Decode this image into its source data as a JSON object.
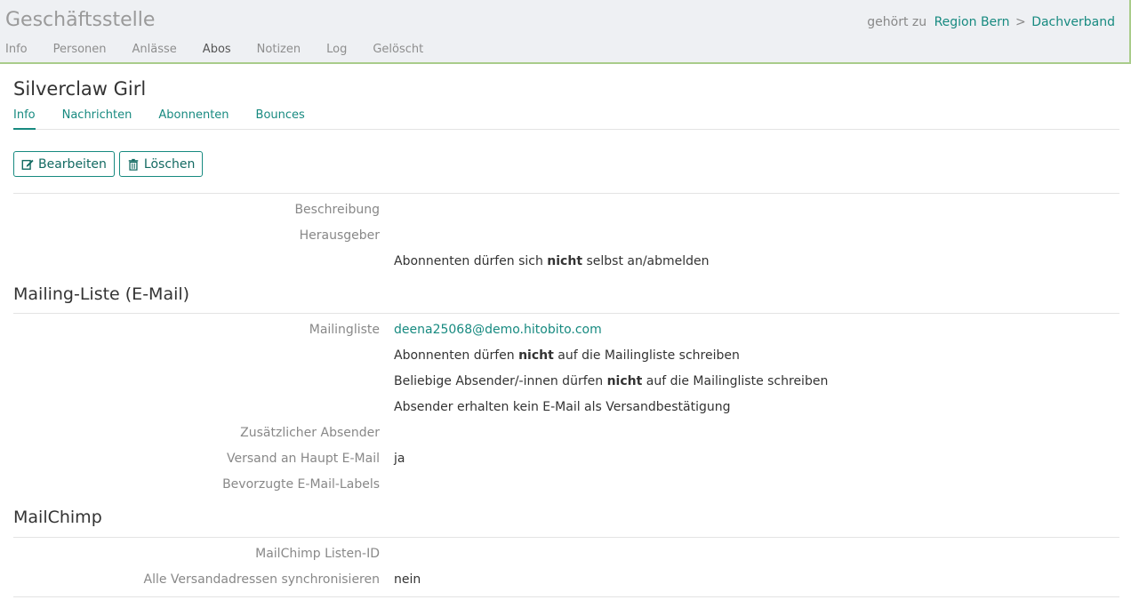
{
  "header": {
    "group_title": "Geschäftsstelle",
    "belongs_to_label": "gehört zu",
    "crumbs": [
      "Region Bern",
      ">",
      "Dachverband"
    ],
    "nav": [
      "Info",
      "Personen",
      "Anlässe",
      "Abos",
      "Notizen",
      "Log",
      "Gelöscht"
    ],
    "active_nav": "Abos"
  },
  "page": {
    "title": "Silverclaw Girl",
    "tabs": [
      "Info",
      "Nachrichten",
      "Abonnenten",
      "Bounces"
    ],
    "active_tab": "Info"
  },
  "actions": {
    "edit": "Bearbeiten",
    "delete": "Löschen"
  },
  "general": {
    "beschreibung_label": "Beschreibung",
    "herausgeber_label": "Herausgeber",
    "subscribe_text": {
      "pre": "Abonnenten dürfen sich",
      "bold": "nicht",
      "post": "selbst an/abmelden"
    }
  },
  "mailing": {
    "title": "Mailing-Liste (E-Mail)",
    "mailingliste_label": "Mailingliste",
    "email": "deena25068@demo.hitobito.com",
    "line1": {
      "pre": "Abonnenten dürfen",
      "bold": "nicht",
      "post": "auf die Mailingliste schreiben"
    },
    "line2": {
      "pre": "Beliebige Absender/-innen dürfen",
      "bold": "nicht",
      "post": "auf die Mailingliste schreiben"
    },
    "line3": "Absender erhalten kein E-Mail als Versandbestätigung",
    "zusaetzlich_label": "Zusätzlicher Absender",
    "haupt_label": "Versand an Haupt E-Mail",
    "haupt_value": "ja",
    "labels_label": "Bevorzugte E-Mail-Labels"
  },
  "mailchimp": {
    "title": "MailChimp",
    "listen_label": "MailChimp Listen-ID",
    "sync_label": "Alle Versandadressen synchronisieren",
    "sync_value": "nein"
  },
  "colors": {
    "accent": "#178a80",
    "topbar_bg": "#eef0f3",
    "topbar_border": "#a9cc8a"
  }
}
